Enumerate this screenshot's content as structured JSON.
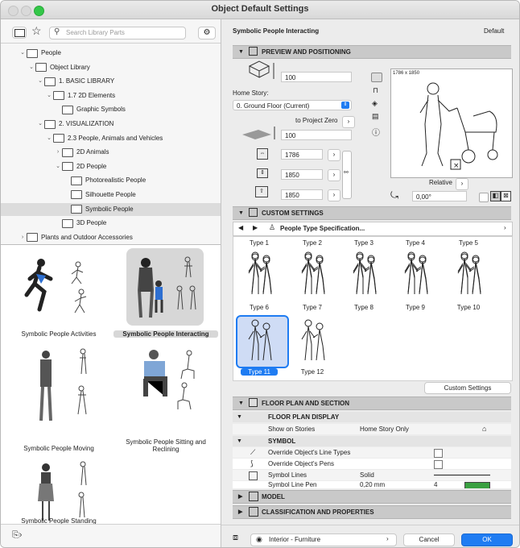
{
  "window": {
    "title": "Object Default Settings"
  },
  "search": {
    "placeholder": "Search Library Parts"
  },
  "tree": [
    {
      "label": "People",
      "level": 1,
      "chev": "v"
    },
    {
      "label": "Object Library",
      "level": 2,
      "chev": "v"
    },
    {
      "label": "1. BASIC LIBRARY",
      "level": 3,
      "chev": "v"
    },
    {
      "label": "1.7 2D Elements",
      "level": 4,
      "chev": "v"
    },
    {
      "label": "Graphic Symbols",
      "level": 5,
      "chev": ""
    },
    {
      "label": "2. VISUALIZATION",
      "level": 3,
      "chev": "v"
    },
    {
      "label": "2.3 People, Animals and Vehicles",
      "level": 4,
      "chev": "v"
    },
    {
      "label": "2D Animals",
      "level": 5,
      "chev": ">"
    },
    {
      "label": "2D People",
      "level": 5,
      "chev": "v"
    },
    {
      "label": "Photorealistic People",
      "level": 6,
      "chev": ""
    },
    {
      "label": "Silhouette People",
      "level": 6,
      "chev": ""
    },
    {
      "label": "Symbolic People",
      "level": 6,
      "chev": ""
    },
    {
      "label": "3D People",
      "level": 5,
      "chev": ""
    },
    {
      "label": "Plants and Outdoor Accessories",
      "level": 1,
      "chev": ">"
    }
  ],
  "thumbs": [
    {
      "label": "Symbolic People Activities"
    },
    {
      "label": "Symbolic People Interacting"
    },
    {
      "label": "Symbolic People Moving"
    },
    {
      "label": "Symbolic People Sitting and Reclining"
    },
    {
      "label": "Symbolic People Standing"
    }
  ],
  "header": {
    "object_name": "Symbolic People Interacting",
    "default_label": "Default"
  },
  "sections": {
    "preview": "PREVIEW AND POSITIONING",
    "custom": "CUSTOM SETTINGS",
    "floor": "FLOOR PLAN AND SECTION",
    "model": "MODEL",
    "classification": "CLASSIFICATION AND PROPERTIES"
  },
  "preview": {
    "elevation_value": "100",
    "home_story_label": "Home Story:",
    "home_story_value": "0. Ground Floor (Current)",
    "to_project_zero": "to Project Zero",
    "project_zero_value": "100",
    "width_value": "1786",
    "depth_value": "1850",
    "height_value": "1850",
    "preview_size": "1786 x 1850",
    "relative_label": "Relative",
    "angle_value": "0,00°"
  },
  "custom": {
    "spec_label": "People Type Specification...",
    "types": [
      "Type 1",
      "Type 2",
      "Type 3",
      "Type 4",
      "Type 5",
      "Type 6",
      "Type 7",
      "Type 8",
      "Type 9",
      "Type 10",
      "Type 11",
      "Type 12"
    ],
    "custom_settings_button": "Custom Settings"
  },
  "floor": {
    "display_header": "FLOOR PLAN DISPLAY",
    "show_on_stories_label": "Show on Stories",
    "show_on_stories_value": "Home Story Only",
    "symbol_header": "SYMBOL",
    "override_line_types": "Override Object's Line Types",
    "override_pens": "Override Object's Pens",
    "symbol_lines_label": "Symbol Lines",
    "symbol_lines_value": "Solid",
    "symbol_line_pen_label": "Symbol Line Pen",
    "symbol_line_pen_value": "0,20 mm",
    "pen_number": "4"
  },
  "footer": {
    "layer": "Interior - Furniture",
    "cancel": "Cancel",
    "ok": "OK"
  },
  "colors": {
    "accent": "#1f7cf2",
    "selection": "#dcdcdc",
    "traffic_close": "#fc5f57",
    "traffic_min": "#fdbc2e",
    "traffic_max": "#33c748"
  }
}
